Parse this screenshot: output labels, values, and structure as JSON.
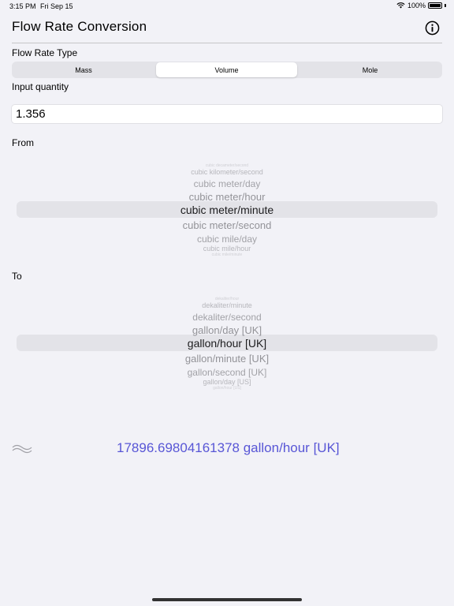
{
  "status_bar": {
    "time": "3:15 PM",
    "date": "Fri Sep 15",
    "battery": "100%"
  },
  "nav": {
    "title": "Flow Rate Conversion",
    "info_icon": "info-circle-icon"
  },
  "flow_type": {
    "label": "Flow Rate Type",
    "segments": [
      "Mass",
      "Volume",
      "Mole"
    ],
    "selected": "Volume"
  },
  "input": {
    "label": "Input quantity",
    "value": "1.356"
  },
  "from": {
    "label": "From",
    "rows": [
      "cubic decameter/second",
      "cubic kilometer/second",
      "cubic meter/day",
      "cubic meter/hour",
      "cubic meter/minute",
      "cubic meter/second",
      "cubic mile/day",
      "cubic mile/hour",
      "cubic mile/minute"
    ],
    "selected": "cubic meter/minute"
  },
  "to": {
    "label": "To",
    "rows": [
      "dekaliter/hour",
      "dekaliter/minute",
      "dekaliter/second",
      "gallon/day [UK]",
      "gallon/hour [UK]",
      "gallon/minute [UK]",
      "gallon/second [UK]",
      "gallon/day [US]",
      "gallon/hour [US]"
    ],
    "selected": "gallon/hour [UK]"
  },
  "result": {
    "icon": "approx-icon",
    "text": "17896.69804161378 gallon/hour [UK]"
  },
  "colors": {
    "accent": "#5856d6",
    "background": "#f2f2f7",
    "selection": "#e3e3e8"
  }
}
